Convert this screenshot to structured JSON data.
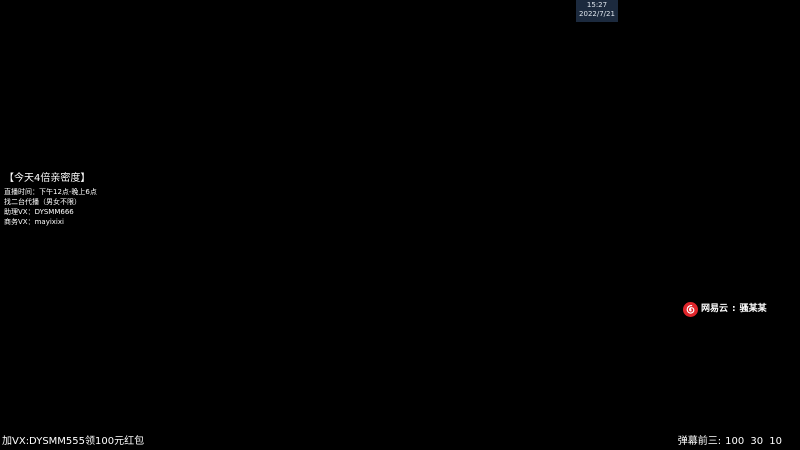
{
  "clock": {
    "time": "15:27",
    "date": "2022/7/21"
  },
  "info": {
    "title": "【今天4倍亲密度】",
    "lines": [
      "直播时间：下午12点-晚上6点",
      "找二台代播（男女不限）",
      "助理VX：DYSMM666",
      "商务VX：mayixixi"
    ]
  },
  "now_playing": {
    "logo_icon": "netease-music-icon",
    "logo_color": "#e0252b",
    "app_name": "网易云",
    "separator": ":",
    "track": "骚某某"
  },
  "promo": {
    "text": "加VX:DYSMM555领100元红包"
  },
  "ranking": {
    "label": "弹幕前三:",
    "scores": "100 30 10"
  }
}
